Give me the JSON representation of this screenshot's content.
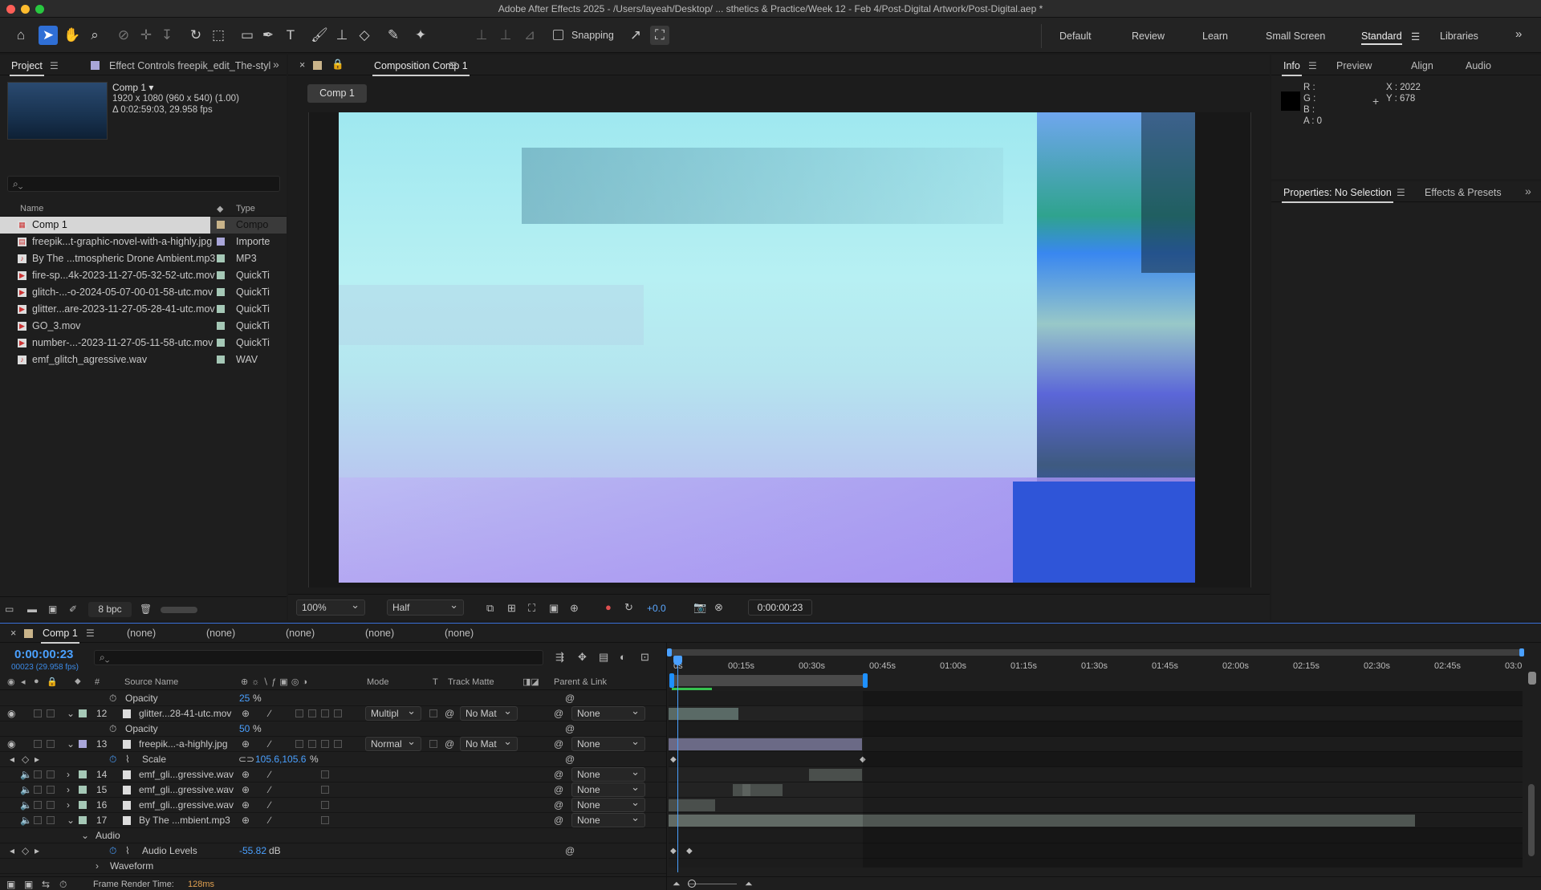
{
  "app": {
    "title": "Adobe After Effects 2025 - /Users/layeah/Desktop/ ... sthetics & Practice/Week 12 - Feb 4/Post-Digital Artwork/Post-Digital.aep *"
  },
  "toolbar": {
    "snapping_label": "Snapping",
    "workspaces": [
      "Default",
      "Review",
      "Learn",
      "Small Screen",
      "Standard",
      "Libraries"
    ],
    "active_workspace": "Standard"
  },
  "project": {
    "tab_project": "Project",
    "tab_effect": "Effect Controls freepik_edit_The-styl",
    "comp_name": "Comp 1 ▾",
    "comp_size": "1920 x 1080  (960 x 540) (1.00)",
    "comp_duration": "Δ 0:02:59:03, 29.958 fps",
    "col_name": "Name",
    "col_type": "Type",
    "items": [
      {
        "name": "Comp 1",
        "type": "Compo",
        "kind": "comp",
        "color": "#c9b48a"
      },
      {
        "name": "freepik...t-graphic-novel-with-a-highly.jpg",
        "type": "Importe",
        "kind": "image",
        "color": "#a9a6d9"
      },
      {
        "name": "By The ...tmospheric Drone Ambient.mp3",
        "type": "MP3",
        "kind": "audio",
        "color": "#a5c8b6"
      },
      {
        "name": "fire-sp...4k-2023-11-27-05-32-52-utc.mov",
        "type": "QuickTi",
        "kind": "video",
        "color": "#a5c8b6"
      },
      {
        "name": "glitch-...-o-2024-05-07-00-01-58-utc.mov",
        "type": "QuickTi",
        "kind": "video",
        "color": "#a5c8b6"
      },
      {
        "name": "glitter...are-2023-11-27-05-28-41-utc.mov",
        "type": "QuickTi",
        "kind": "video",
        "color": "#a5c8b6"
      },
      {
        "name": "GO_3.mov",
        "type": "QuickTi",
        "kind": "video",
        "color": "#a5c8b6"
      },
      {
        "name": "number-...-2023-11-27-05-11-58-utc.mov",
        "type": "QuickTi",
        "kind": "video",
        "color": "#a5c8b6"
      },
      {
        "name": "emf_glitch_agressive.wav",
        "type": "WAV",
        "kind": "audio",
        "color": "#a5c8b6"
      }
    ],
    "bpc": "8 bpc"
  },
  "composition": {
    "tab": "Composition Comp 1",
    "breadcrumb": "Comp 1",
    "zoom": "100%",
    "resolution": "Half",
    "exposure": "+0.0",
    "timecode": "0:00:00:23"
  },
  "info": {
    "tabs": [
      "Info",
      "Preview",
      "Align",
      "Audio"
    ],
    "r": "R :",
    "g": "G :",
    "b": "B :",
    "a": "A :  0",
    "x": "X : 2022",
    "y": "Y :  678"
  },
  "properties": {
    "tabs": [
      "Properties: No Selection",
      "Effects & Presets"
    ]
  },
  "timeline": {
    "tab": "Comp 1",
    "other_tabs": [
      "(none)",
      "(none)",
      "(none)",
      "(none)",
      "(none)"
    ],
    "timecode": "0:00:00:23",
    "frame_info": "00023 (29.958 fps)",
    "cols": {
      "hash": "#",
      "source": "Source Name",
      "mode": "Mode",
      "t": "T",
      "matte": "Track Matte",
      "parent": "Parent & Link"
    },
    "ruler": [
      "0s",
      "00:15s",
      "00:30s",
      "00:45s",
      "01:00s",
      "01:15s",
      "01:30s",
      "01:45s",
      "02:00s",
      "02:15s",
      "02:30s",
      "02:45s",
      "03:0"
    ],
    "layers": [
      {
        "type": "prop",
        "label": "Opacity",
        "value": "25",
        "unit": "%"
      },
      {
        "type": "layer",
        "num": "12",
        "name": "glitter...28-41-utc.mov",
        "mode": "Multipl",
        "matte": "No Mat",
        "parent": "None",
        "kind": "video",
        "color": "#a5c8b6"
      },
      {
        "type": "prop",
        "label": "Opacity",
        "value": "50",
        "unit": "%"
      },
      {
        "type": "layer",
        "num": "13",
        "name": "freepik...-a-highly.jpg",
        "mode": "Normal",
        "matte": "No Mat",
        "parent": "None",
        "kind": "image",
        "color": "#a9a6d9"
      },
      {
        "type": "scale",
        "label": "Scale",
        "value": "105.6,105.6",
        "unit": "%"
      },
      {
        "type": "audio",
        "num": "14",
        "name": "emf_gli...gressive.wav",
        "parent": "None",
        "color": "#a5c8b6"
      },
      {
        "type": "audio",
        "num": "15",
        "name": "emf_gli...gressive.wav",
        "parent": "None",
        "color": "#a5c8b6"
      },
      {
        "type": "audio",
        "num": "16",
        "name": "emf_gli...gressive.wav",
        "parent": "None",
        "color": "#a5c8b6"
      },
      {
        "type": "audio",
        "num": "17",
        "name": "By The ...mbient.mp3",
        "parent": "None",
        "color": "#a5c8b6",
        "open": true
      },
      {
        "type": "group",
        "label": "Audio"
      },
      {
        "type": "levels",
        "label": "Audio Levels",
        "value": "-55.82",
        "unit": "dB"
      },
      {
        "type": "group2",
        "label": "Waveform"
      }
    ],
    "render_label": "Frame Render Time:",
    "render_value": "128ms"
  }
}
